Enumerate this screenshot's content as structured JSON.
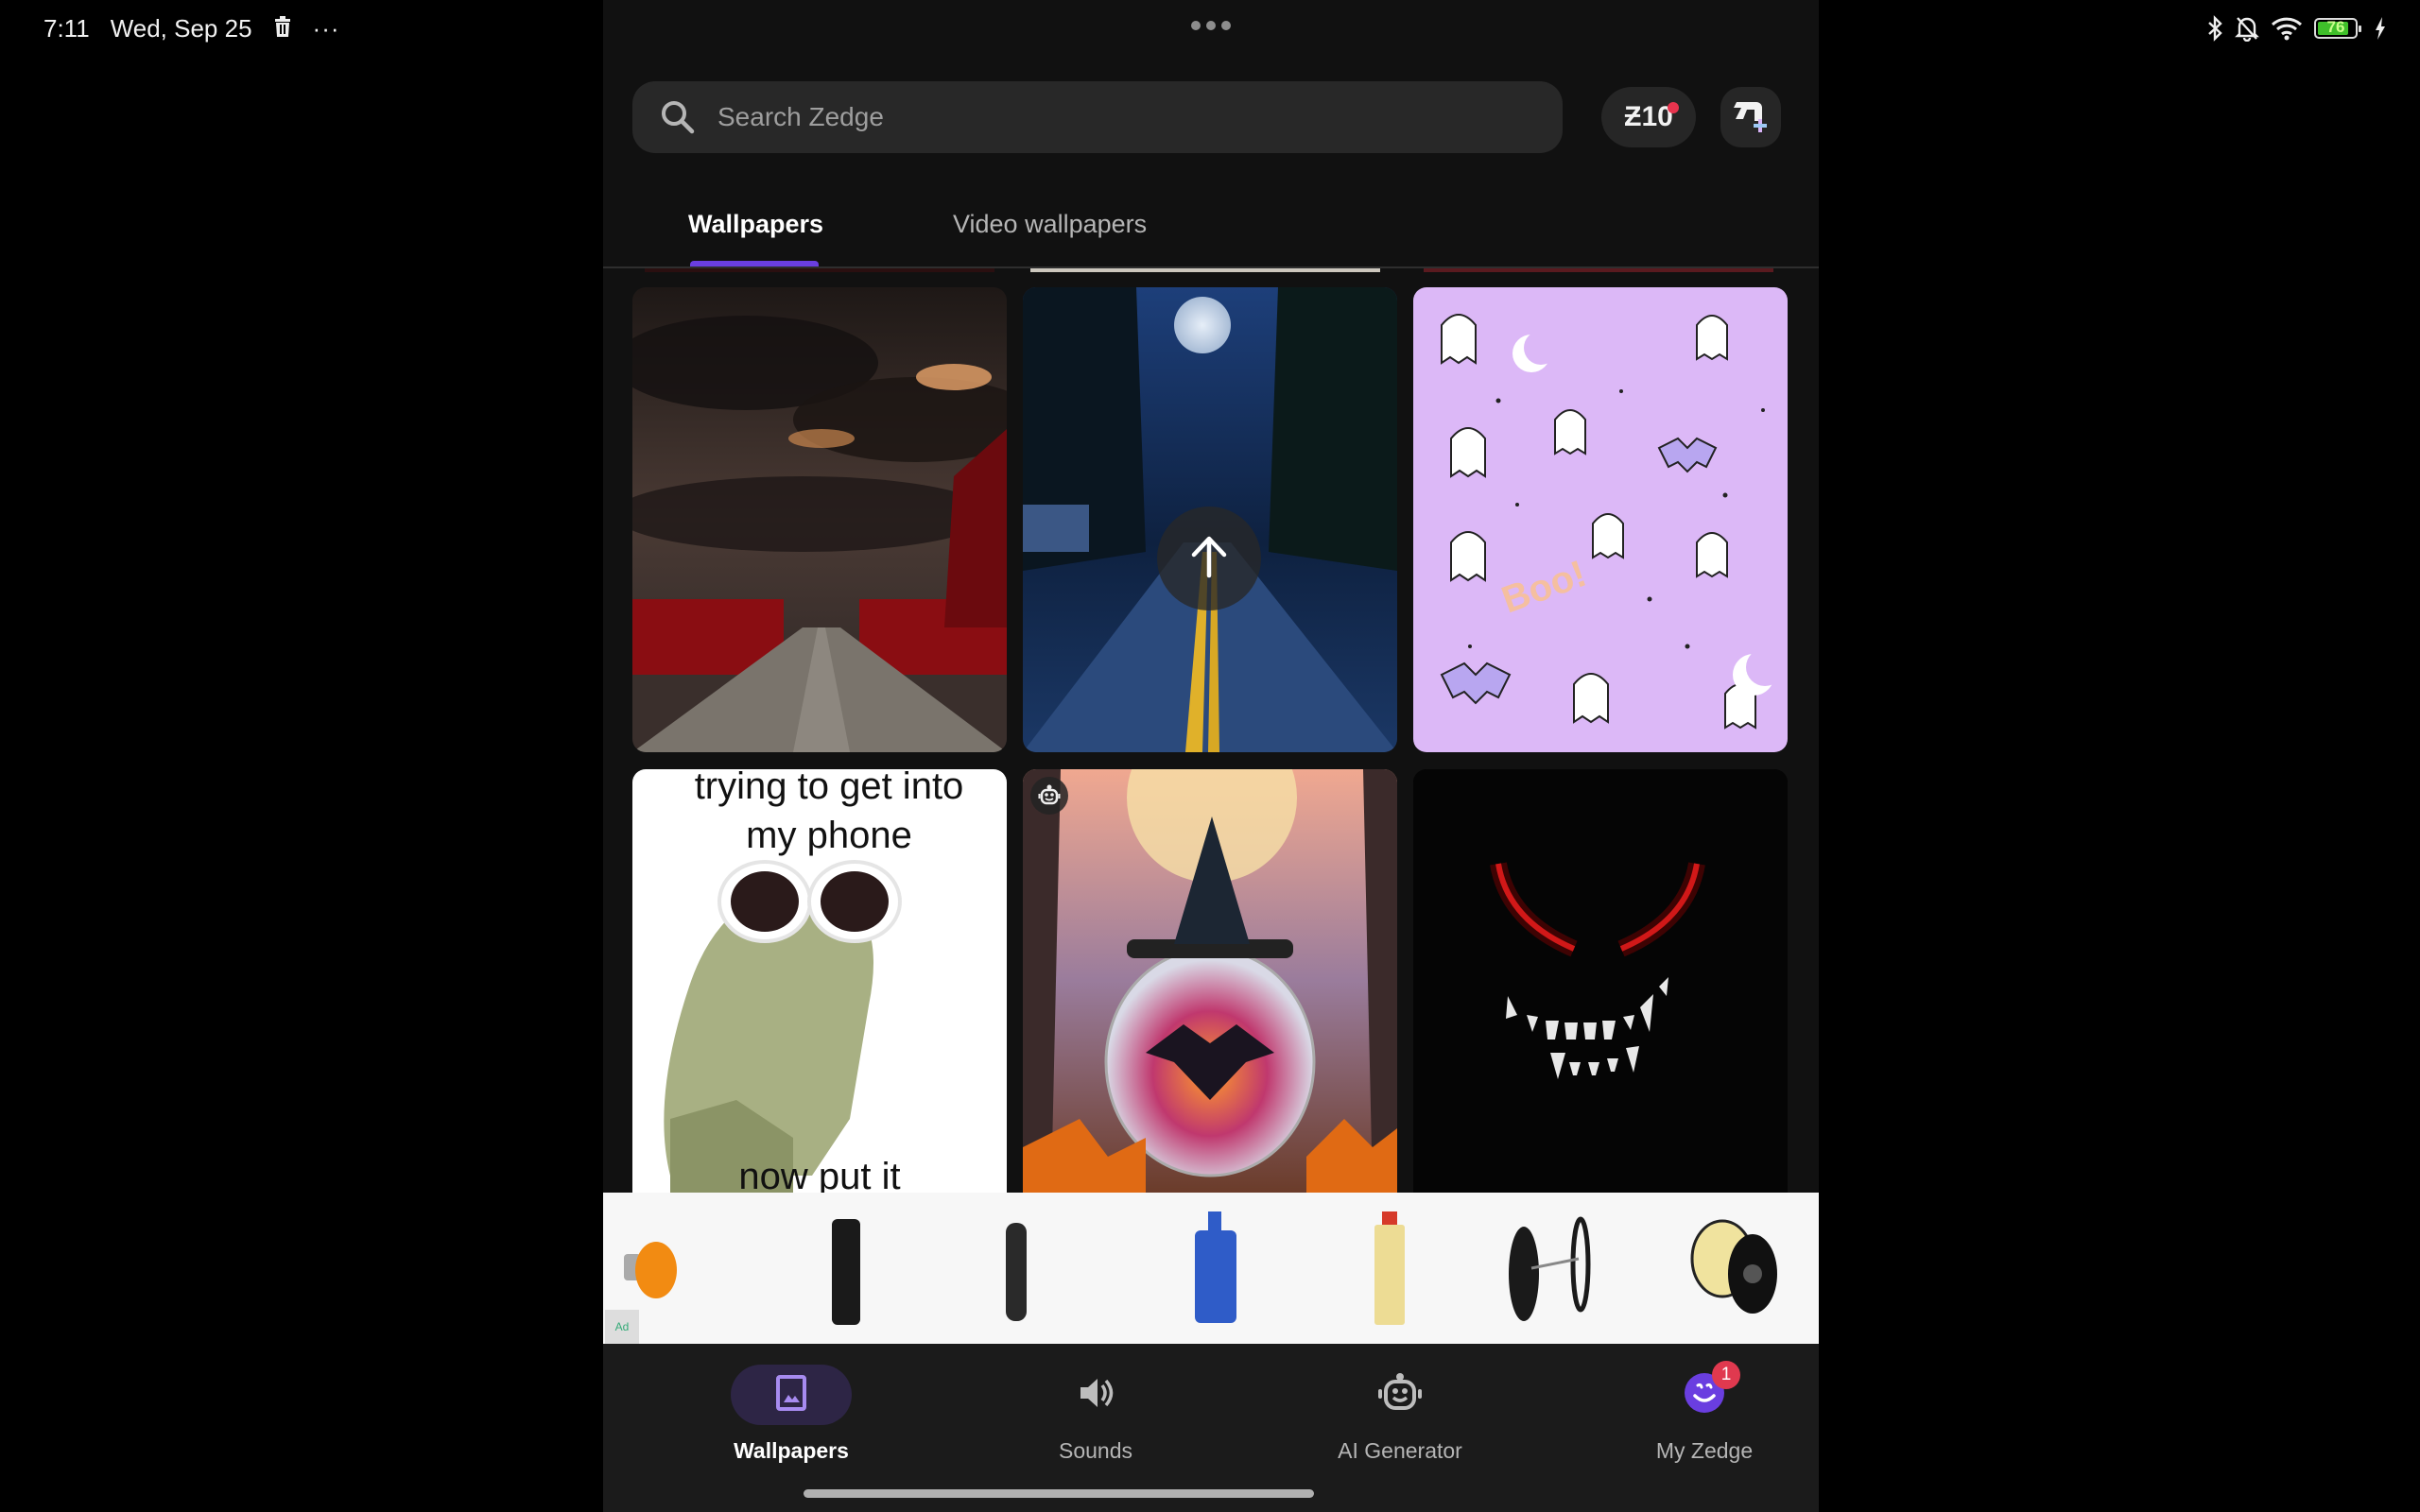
{
  "status_bar": {
    "time": "7:11",
    "date": "Wed, Sep 25",
    "left_icons": [
      "trash-icon",
      "more-horizontal-icon"
    ],
    "right_icons": [
      "bluetooth-icon",
      "notifications-off-icon",
      "wifi-icon",
      "battery-icon",
      "charging-icon"
    ],
    "battery_percent": 76
  },
  "search": {
    "placeholder": "Search Zedge",
    "value": ""
  },
  "header": {
    "coins_label": "Ƶ10",
    "coins_notification": true,
    "create_icon": "create-upload-icon"
  },
  "tabs": [
    {
      "label": "Wallpapers",
      "active": true
    },
    {
      "label": "Video wallpapers",
      "active": false
    }
  ],
  "grid": {
    "items": [
      {
        "description": "Stormy clouds over road with red trees"
      },
      {
        "description": "Moonlit forest road at night"
      },
      {
        "description": "Purple Halloween ghosts and bats pattern",
        "text": "Boo!"
      },
      {
        "description": "Meme frog with sunglasses",
        "caption_top": "trying to get into my phone",
        "caption_bottom": "now put it"
      },
      {
        "description": "Witch hat on glass jar with bats",
        "badge": "ai-generated-icon"
      },
      {
        "description": "Red glowing eyes and fanged grin in darkness"
      }
    ],
    "scroll_to_top_icon": "arrow-up-icon"
  },
  "ad": {
    "badge": "Ad",
    "products": [
      "bulb",
      "oil-container-black",
      "seal-ring",
      "oil-jug-blue",
      "fluid-bottle",
      "pulley",
      "fuel-filter"
    ]
  },
  "bottom_nav": [
    {
      "label": "Wallpapers",
      "icon": "wallpaper-icon",
      "active": true
    },
    {
      "label": "Sounds",
      "icon": "speaker-icon",
      "active": false
    },
    {
      "label": "AI Generator",
      "icon": "ai-robot-icon",
      "active": false
    },
    {
      "label": "My Zedge",
      "icon": "profile-smiley-icon",
      "active": false,
      "badge": "1"
    }
  ],
  "colors": {
    "accent": "#6a3ee0",
    "badge_red": "#e0394f",
    "background": "#111111"
  }
}
